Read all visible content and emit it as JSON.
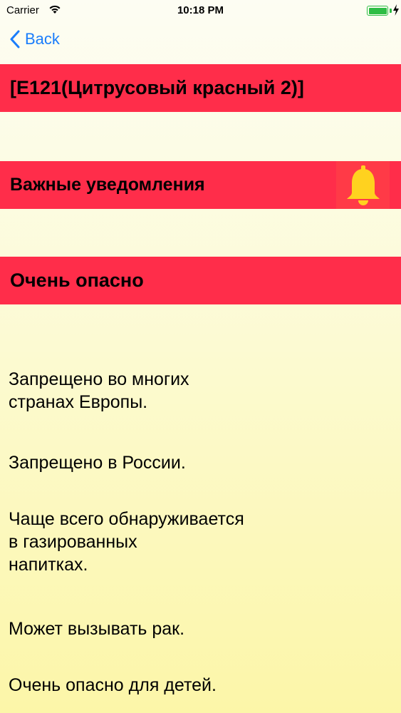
{
  "status_bar": {
    "carrier": "Carrier",
    "time": "10:18 PM"
  },
  "nav": {
    "back_label": "Back"
  },
  "additive": {
    "title": "[E121(Цитрусовый красный 2)]"
  },
  "notifications": {
    "label": "Важные уведомления",
    "icon": "bell-icon"
  },
  "danger": {
    "label": "Очень опасно"
  },
  "facts": [
    {
      "line1": "Запрещено во многих",
      "line2": "странах Европы."
    },
    {
      "line1": "Запрещено в России."
    },
    {
      "line1": "Чаще всего обнаруживается",
      "line2": "в газированных",
      "line3": "напитках."
    },
    {
      "line1": "Может вызывать рак."
    },
    {
      "line1": "Очень опасно для детей."
    }
  ],
  "colors": {
    "banner": "#ff2d4a",
    "accent": "#1a7dfb",
    "bell": "#ffd21f",
    "battery": "#2ebd45"
  }
}
